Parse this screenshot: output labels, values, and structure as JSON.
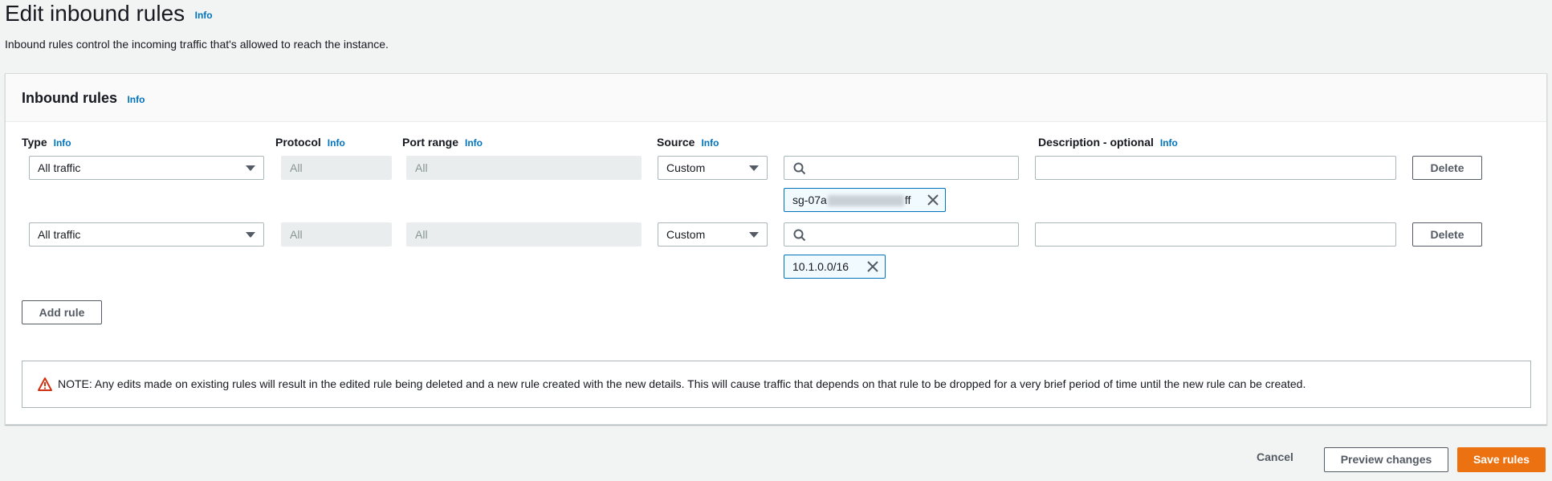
{
  "header": {
    "title": "Edit inbound rules",
    "info": "Info",
    "description": "Inbound rules control the incoming traffic that's allowed to reach the instance."
  },
  "panel": {
    "title": "Inbound rules",
    "info": "Info",
    "columns": {
      "type": "Type",
      "protocol": "Protocol",
      "port_range": "Port range",
      "source": "Source",
      "description": "Description - optional",
      "info": "Info"
    },
    "rules": [
      {
        "type": "All traffic",
        "protocol": "All",
        "port_range": "All",
        "source_type": "Custom",
        "source_search": "",
        "source_token_prefix": "sg-07a",
        "source_token_suffix": "ff",
        "description": "",
        "delete_label": "Delete"
      },
      {
        "type": "All traffic",
        "protocol": "All",
        "port_range": "All",
        "source_type": "Custom",
        "source_search": "",
        "source_token": "10.1.0.0/16",
        "description": "",
        "delete_label": "Delete"
      }
    ],
    "add_rule_label": "Add rule",
    "note": "NOTE: Any edits made on existing rules will result in the edited rule being deleted and a new rule created with the new details. This will cause traffic that depends on that rule to be dropped for a very brief period of time until the new rule can be created."
  },
  "footer": {
    "cancel_label": "Cancel",
    "preview_label": "Preview changes",
    "save_label": "Save rules"
  },
  "colors": {
    "link": "#0073bb",
    "primary": "#ec7211",
    "token_border": "#0073bb",
    "warning": "#d13212"
  },
  "icons": [
    "search-icon",
    "close-icon",
    "warning-icon",
    "caret-down-icon"
  ]
}
